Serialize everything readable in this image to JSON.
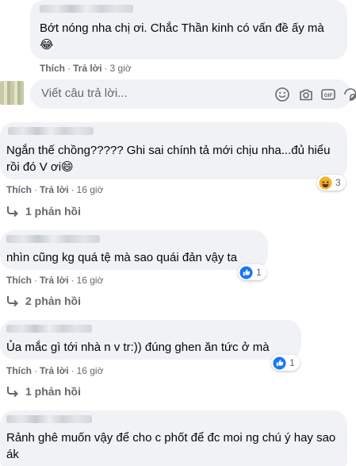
{
  "comments": [
    {
      "text": "Bớt nóng nha chị ơi. Chắc Thần kinh có vấn đề ấy mà 😂",
      "like_label": "Thích",
      "reply_label": "Trả lời",
      "time": "3 giờ"
    },
    {
      "text": "Ngắn thế chồng????? Ghi sai chính tả mới chịu nha...đủ hiểu rồi đó V ơi😄",
      "like_label": "Thích",
      "reply_label": "Trả lời",
      "time": "16 giờ",
      "reaction_count": "3",
      "replies_label": "1 phản hồi"
    },
    {
      "text": "nhìn cũng kg quá tệ mà sao quái đản vậy ta",
      "like_label": "Thích",
      "reply_label": "Trả lời",
      "time": "16 giờ",
      "reaction_count": "1",
      "replies_label": "2 phản hồi"
    },
    {
      "text": "Ủa mắc gì tới nhà n v tr:)) đúng ghen ăn tức ở mà",
      "like_label": "Thích",
      "reply_label": "Trả lời",
      "time": "16 giờ",
      "reaction_count": "1",
      "replies_label": "1 phản hồi"
    },
    {
      "text": "Rảnh ghê muốn vậy để cho c phốt để đc moi ng chú ý hay sao ák"
    }
  ],
  "reply_input": {
    "placeholder": "Viết câu trả lời..."
  },
  "icons": {
    "emoji": "smiley-icon",
    "camera": "camera-icon",
    "gif": "gif-icon",
    "sticker": "sticker-icon",
    "reply_arrow": "reply-arrow-icon",
    "like_reaction": "like-reaction-icon",
    "haha_reaction": "haha-reaction-icon"
  },
  "colors": {
    "bubble": "#f0f2f5",
    "meta_text": "#65676b",
    "like_blue": "#1877f2",
    "haha_yellow": "#f7b125"
  }
}
